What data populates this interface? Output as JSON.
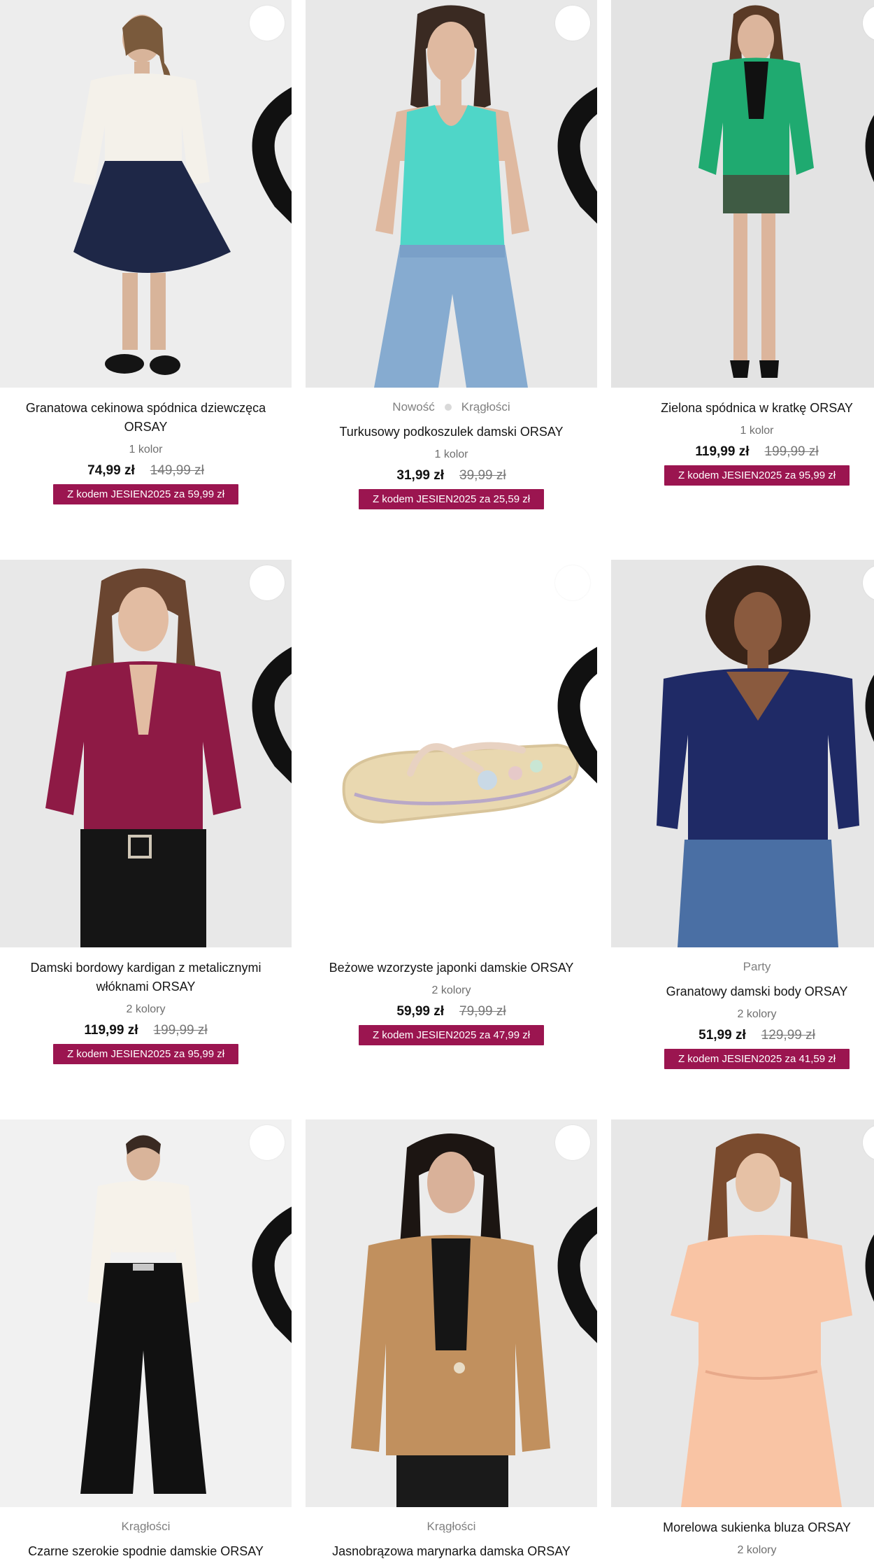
{
  "products": [
    {
      "tags": [],
      "title": "Granatowa cekinowa spódnica dziewczęca ORSAY",
      "colors": "1 kolor",
      "price": "74,99 zł",
      "old_price": "149,99 zł",
      "promo": "Z kodem JESIEN2025 za 59,99 zł",
      "image": "girl-sequin-skirt"
    },
    {
      "tags": [
        "Nowość",
        "Krągłości"
      ],
      "title": "Turkusowy podkoszulek damski ORSAY",
      "colors": "1 kolor",
      "price": "31,99 zł",
      "old_price": "39,99 zł",
      "promo": "Z kodem JESIEN2025 za 25,59 zł",
      "image": "turquoise-tank-top"
    },
    {
      "tags": [],
      "title": "Zielona spódnica w kratkę ORSAY",
      "colors": "1 kolor",
      "price": "119,99 zł",
      "old_price": "199,99 zł",
      "promo": "Z kodem JESIEN2025 za 95,99 zł",
      "image": "green-blazer-check-skirt"
    },
    {
      "tags": [],
      "title": "Damski bordowy kardigan z metalicznymi włóknami ORSAY",
      "colors": "2 kolory",
      "price": "119,99 zł",
      "old_price": "199,99 zł",
      "promo": "Z kodem JESIEN2025 za 95,99 zł",
      "image": "burgundy-cardigan"
    },
    {
      "tags": [],
      "title": "Beżowe wzorzyste japonki damskie ORSAY",
      "colors": "2 kolory",
      "price": "59,99 zł",
      "old_price": "79,99 zł",
      "promo": "Z kodem JESIEN2025 za 47,99 zł",
      "image": "beige-flip-flop"
    },
    {
      "tags": [
        "Party"
      ],
      "title": "Granatowy damski body ORSAY",
      "colors": "2 kolory",
      "price": "51,99 zł",
      "old_price": "129,99 zł",
      "promo": "Z kodem JESIEN2025 za 41,59 zł",
      "image": "navy-bodysuit"
    },
    {
      "tags": [
        "Krągłości"
      ],
      "title": "Czarne szerokie spodnie damskie ORSAY",
      "colors": "",
      "price": "",
      "old_price": "",
      "promo": "",
      "image": "black-wide-trousers"
    },
    {
      "tags": [
        "Krągłości"
      ],
      "title": "Jasnobrązowa marynarka damska ORSAY",
      "colors": "",
      "price": "",
      "old_price": "",
      "promo": "",
      "image": "camel-blazer"
    },
    {
      "tags": [],
      "title": "Morelowa sukienka bluza ORSAY",
      "colors": "2 kolory",
      "price": "",
      "old_price": "",
      "promo": "",
      "image": "apricot-dress"
    }
  ],
  "colors": {
    "promo_bg": "#9b1550",
    "price_old": "#777777",
    "tag_text": "#808080"
  }
}
